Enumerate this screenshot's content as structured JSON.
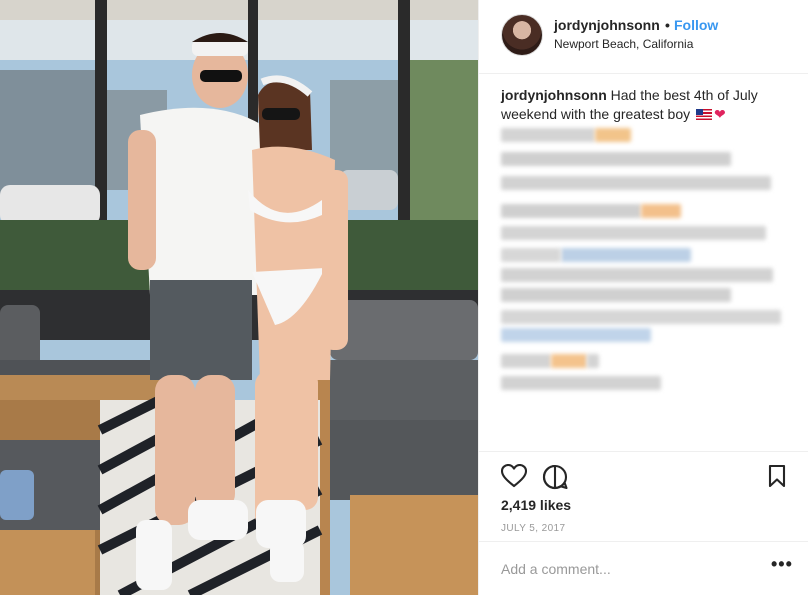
{
  "post": {
    "username": "jordynjohnsonn",
    "separator": "•",
    "follow_label": "Follow",
    "location": "Newport Beach, California",
    "caption_user": "jordynjohnsonn",
    "caption_text": "Had the best 4th of July weekend with the greatest boy",
    "likes": "2,419 likes",
    "date": "JULY 5, 2017",
    "comment_placeholder": "Add a comment...",
    "more_label": "•••"
  },
  "icons": {
    "like": "heart-icon",
    "comment": "comment-icon",
    "save": "bookmark-icon",
    "more": "more-options-icon"
  },
  "colors": {
    "link_blue": "#3897f0",
    "text": "#262626",
    "muted": "#999999",
    "divider": "#efefef"
  }
}
